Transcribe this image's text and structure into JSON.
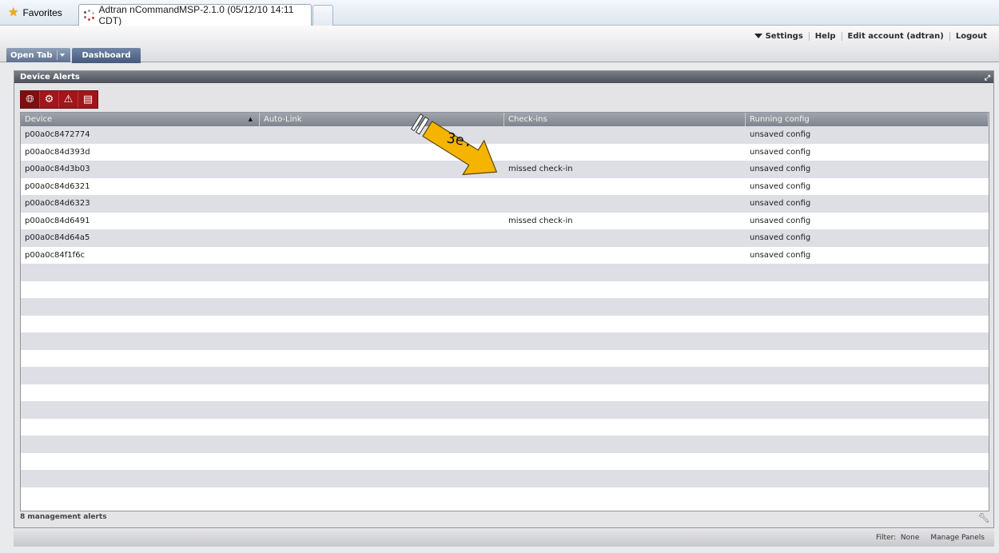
{
  "browser": {
    "favorites_label": "Favorites",
    "tab_title": "Adtran nCommandMSP-2.1.0 (05/12/10 14:11 CDT)"
  },
  "header": {
    "links": [
      "Settings",
      "Help",
      "Edit account (adtran)",
      "Logout"
    ],
    "open_tab_label": "Open Tab",
    "dashboard_tab_label": "Dashboard"
  },
  "panel": {
    "title": "Device Alerts",
    "toolbar_icons": [
      "globe-icon",
      "gear-icon",
      "warning-icon",
      "config-icon"
    ],
    "columns": [
      "Device",
      "Auto-Link",
      "Check-ins",
      "Running config"
    ],
    "rows": [
      {
        "device": "p00a0c8472774",
        "autolink": "",
        "checkins": "",
        "config": "unsaved config"
      },
      {
        "device": "p00a0c84d393d",
        "autolink": "",
        "checkins": "",
        "config": "unsaved config"
      },
      {
        "device": "p00a0c84d3b03",
        "autolink": "",
        "checkins": "missed check-in",
        "config": "unsaved config"
      },
      {
        "device": "p00a0c84d6321",
        "autolink": "",
        "checkins": "",
        "config": "unsaved config"
      },
      {
        "device": "p00a0c84d6323",
        "autolink": "",
        "checkins": "",
        "config": "unsaved config"
      },
      {
        "device": "p00a0c84d6491",
        "autolink": "",
        "checkins": "missed check-in",
        "config": "unsaved config"
      },
      {
        "device": "p00a0c84d64a5",
        "autolink": "",
        "checkins": "",
        "config": "unsaved config"
      },
      {
        "device": "p00a0c84f1f6c",
        "autolink": "",
        "checkins": "",
        "config": "unsaved config"
      }
    ],
    "empty_rows": 14,
    "footer_text": "8 management alerts"
  },
  "statusbar": {
    "filter_label": "Filter:",
    "filter_value": "None",
    "manage_panels": "Manage Panels"
  },
  "annotation": {
    "label": "3e.",
    "arrow_color": "#f5b400"
  }
}
